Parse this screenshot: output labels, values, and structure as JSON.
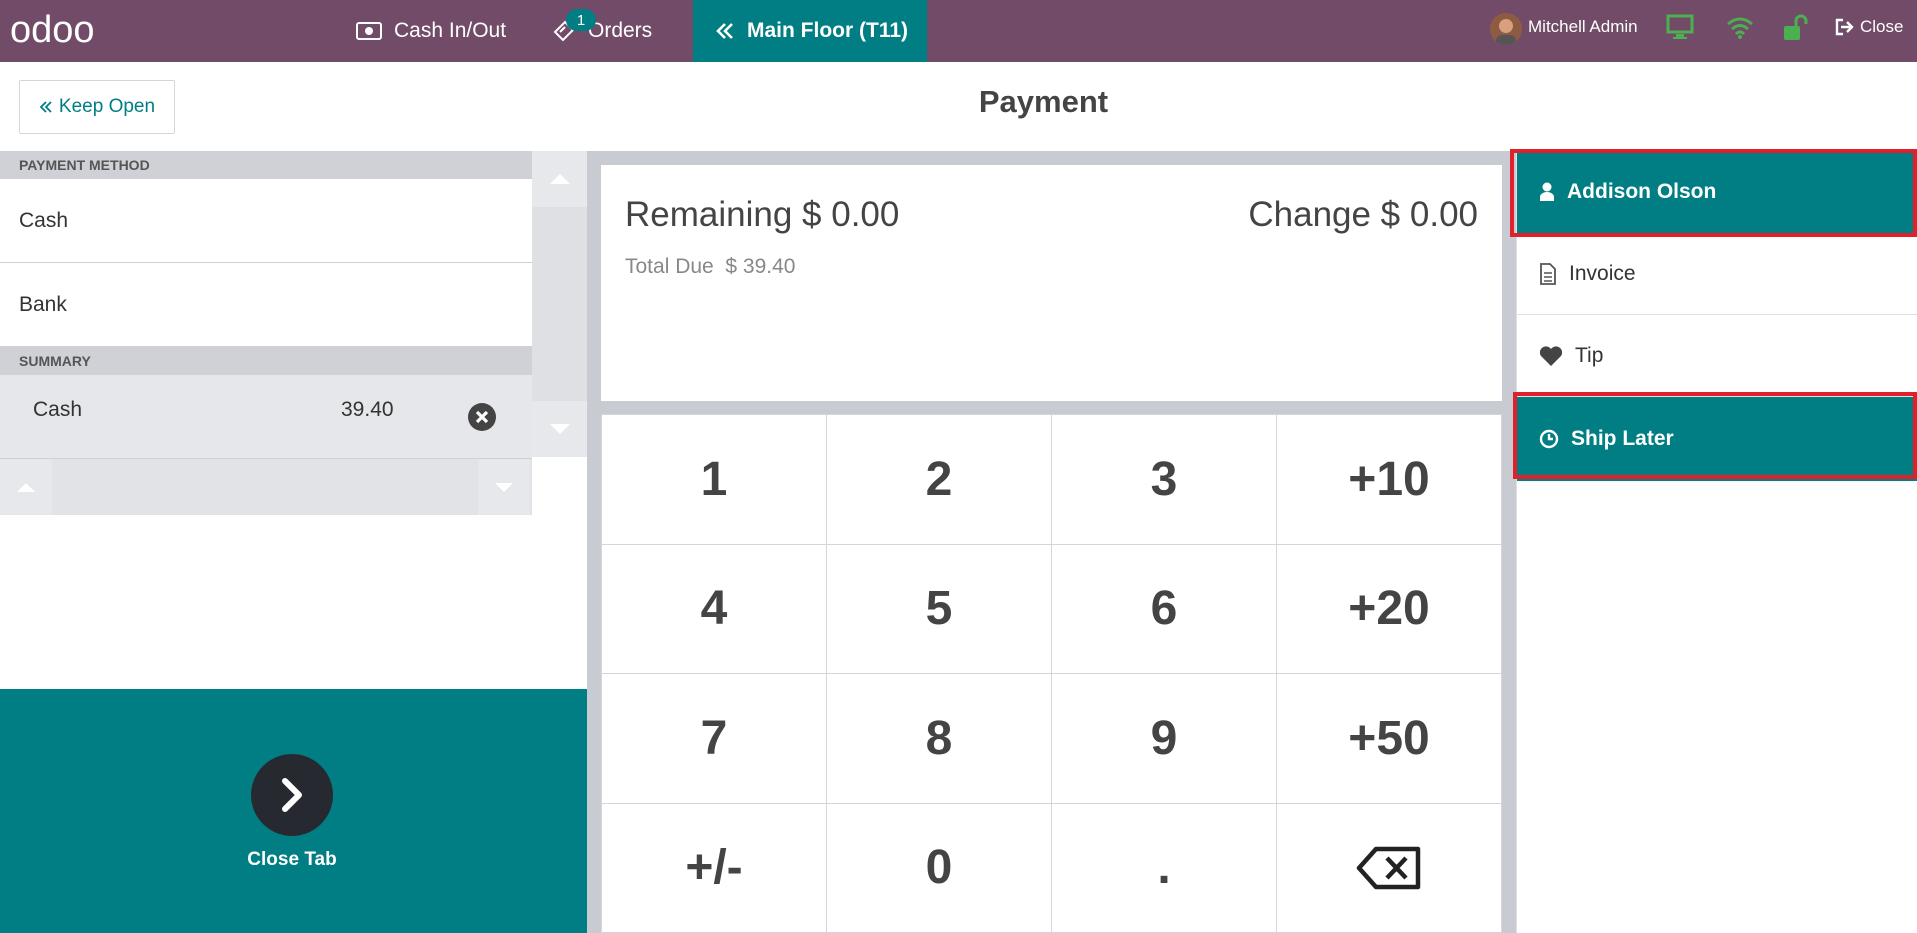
{
  "topbar": {
    "logo_text": "odoo",
    "cash_in_out_label": "Cash In/Out",
    "orders_label": "Orders",
    "orders_badge": "1",
    "floor_label": "Main Floor",
    "table_label": "(T11)",
    "user_name": "Mitchell Admin",
    "close_label": "Close"
  },
  "header": {
    "keep_open_label": "Keep Open",
    "title": "Payment"
  },
  "payment_methods": {
    "header": "PAYMENT METHOD",
    "items": [
      {
        "label": "Cash"
      },
      {
        "label": "Bank"
      }
    ]
  },
  "summary": {
    "header": "SUMMARY",
    "lines": [
      {
        "method": "Cash",
        "amount": "39.40"
      }
    ]
  },
  "close_tab": {
    "label": "Close Tab"
  },
  "amounts": {
    "remaining": "Remaining $ 0.00",
    "change": "Change $ 0.00",
    "total_due_label": "Total Due",
    "total_due_value": "$ 39.40"
  },
  "numpad": {
    "keys": [
      "1",
      "2",
      "3",
      "+10",
      "4",
      "5",
      "6",
      "+20",
      "7",
      "8",
      "9",
      "+50",
      "+/-",
      "0",
      ".",
      "backspace"
    ]
  },
  "actions": {
    "customer": "Addison Olson",
    "invoice": "Invoice",
    "tip": "Tip",
    "ship_later": "Ship Later"
  },
  "colors": {
    "topbar": "#714b67",
    "accent": "#017e84",
    "highlight": "#e0202a",
    "status_green": "#4caf50"
  }
}
